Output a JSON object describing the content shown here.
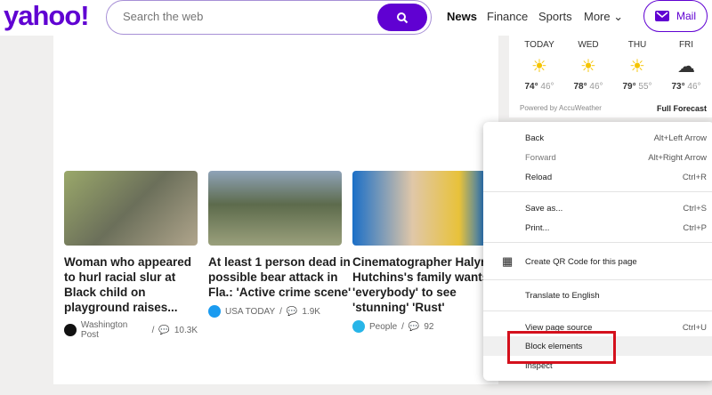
{
  "header": {
    "logo": "yahoo!",
    "search_placeholder": "Search the web",
    "nav": [
      "News",
      "Finance",
      "Sports",
      "More"
    ],
    "mail": "Mail"
  },
  "weather": {
    "days": [
      {
        "name": "TODAY",
        "high": "74°",
        "low": "46°",
        "icon": "partly-sunny"
      },
      {
        "name": "WED",
        "high": "78°",
        "low": "46°",
        "icon": "partly-sunny"
      },
      {
        "name": "THU",
        "high": "79°",
        "low": "55°",
        "icon": "partly-sunny"
      },
      {
        "name": "FRI",
        "high": "73°",
        "low": "46°",
        "icon": "cloudy"
      }
    ],
    "powered": "Powered by AccuWeather",
    "full": "Full Forecast"
  },
  "cards": [
    {
      "title": [
        "Woman who appeared",
        "to hurl racial slur at",
        "Black child on",
        "playground raises..."
      ],
      "source": "Washington Post",
      "comments": "10.3K",
      "color": "#111"
    },
    {
      "title": [
        "At least 1 person dead in",
        "possible bear attack in",
        "Fla.: 'Active crime scene'"
      ],
      "source": "USA TODAY",
      "comments": "1.9K",
      "color": "#1a9bf0"
    },
    {
      "title": [
        "Cinematographer Halyna",
        "Hutchins's family wants",
        "'everybody' to see",
        "'stunning' 'Rust'"
      ],
      "source": "People",
      "comments": "92",
      "color": "#27b5e8"
    }
  ],
  "menu": [
    {
      "label": "Back",
      "shortcut": "Alt+Left Arrow"
    },
    {
      "label": "Forward",
      "shortcut": "Alt+Right Arrow"
    },
    {
      "label": "Reload",
      "shortcut": "Ctrl+R"
    },
    {
      "label": "Save as...",
      "shortcut": "Ctrl+S"
    },
    {
      "label": "Print...",
      "shortcut": "Ctrl+P"
    },
    {
      "label": "Create QR Code for this page",
      "shortcut": ""
    },
    {
      "label": "Translate to English",
      "shortcut": ""
    },
    {
      "label": "View page source",
      "shortcut": "Ctrl+U"
    },
    {
      "label": "Block elements",
      "shortcut": ""
    },
    {
      "label": "Inspect",
      "shortcut": ""
    }
  ]
}
